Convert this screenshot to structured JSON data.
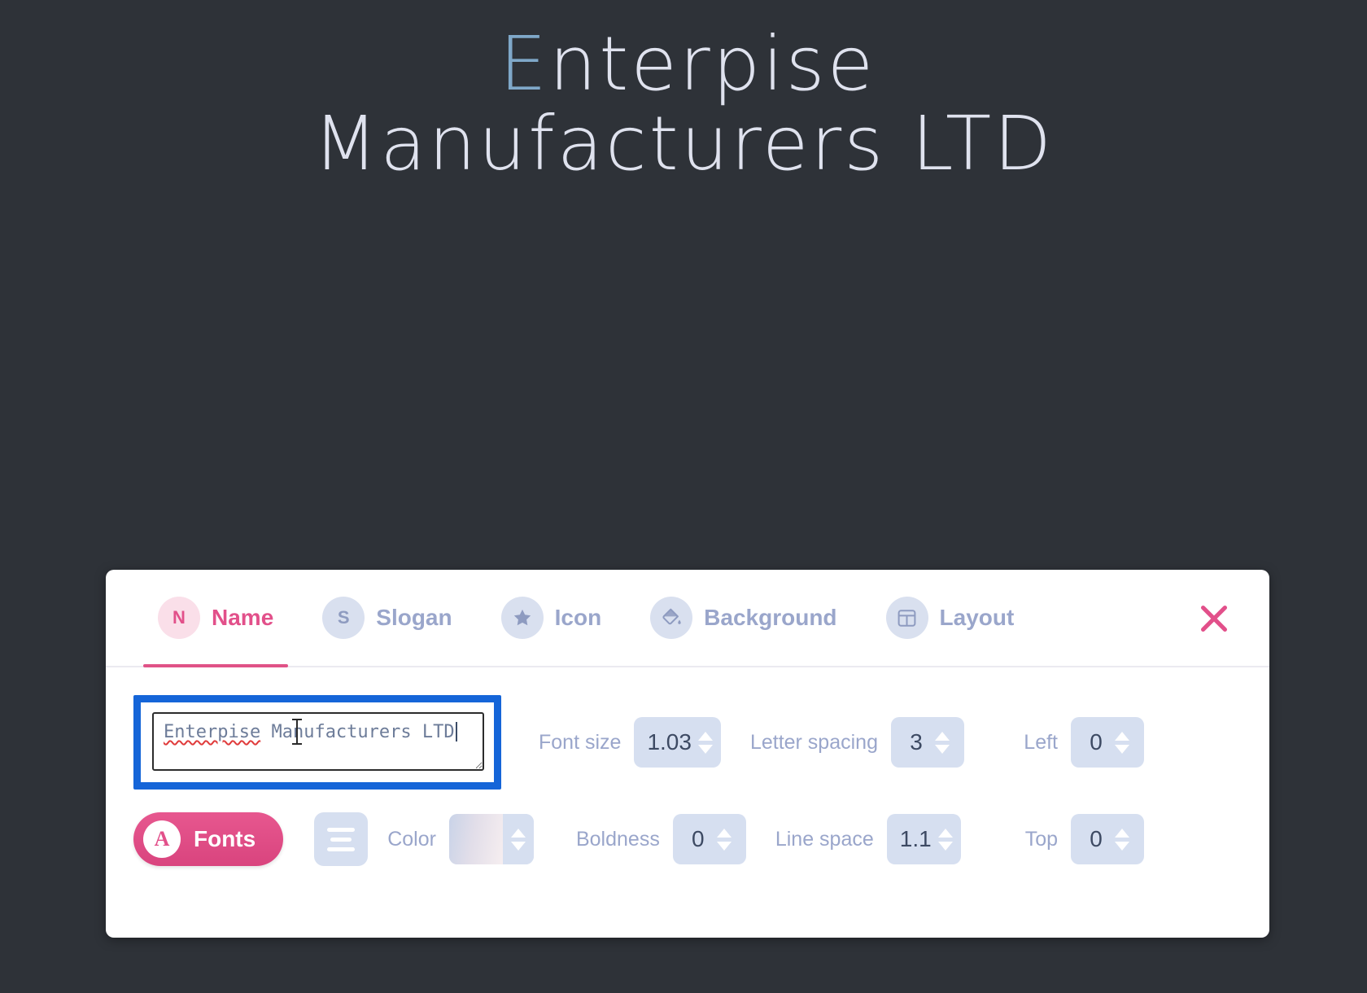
{
  "canvas": {
    "background_color": "#2e3238"
  },
  "logo_preview": {
    "line1_initial": "E",
    "line1_rest": "nterpise",
    "line2": "Manufacturers LTD",
    "initial_color": "#7fa8c9",
    "text_color": "#dfe2ee"
  },
  "panel": {
    "accent_color": "#e2508a",
    "tabs": [
      {
        "icon": "letter-n-badge-icon",
        "badge_text": "N",
        "label": "Name",
        "active": true
      },
      {
        "icon": "letter-s-badge-icon",
        "badge_text": "S",
        "label": "Slogan",
        "active": false
      },
      {
        "icon": "star-icon",
        "badge_text": "",
        "label": "Icon",
        "active": false
      },
      {
        "icon": "paint-bucket-icon",
        "badge_text": "",
        "label": "Background",
        "active": false
      },
      {
        "icon": "layout-grid-icon",
        "badge_text": "",
        "label": "Layout",
        "active": false
      }
    ],
    "close_icon": "close-icon",
    "name_editor": {
      "textarea_value": "Enterpise Manufacturers LTD",
      "misspelled_word": "Enterpise",
      "rest_of_value": " Manufacturers LTD",
      "focused": true,
      "focus_ring_color": "#1565d8"
    },
    "controls": {
      "font_size": {
        "label": "Font size",
        "value": "1.03"
      },
      "letter_spacing": {
        "label": "Letter spacing",
        "value": "3"
      },
      "left": {
        "label": "Left",
        "value": "0"
      },
      "boldness": {
        "label": "Boldness",
        "value": "0"
      },
      "line_space": {
        "label": "Line space",
        "value": "1.1"
      },
      "top": {
        "label": "Top",
        "value": "0"
      }
    },
    "fonts_button": {
      "label": "Fonts",
      "badge": "A"
    },
    "align_button": {
      "icon": "text-align-icon"
    },
    "color_control": {
      "label": "Color",
      "icon": "color-swatch-icon"
    }
  }
}
